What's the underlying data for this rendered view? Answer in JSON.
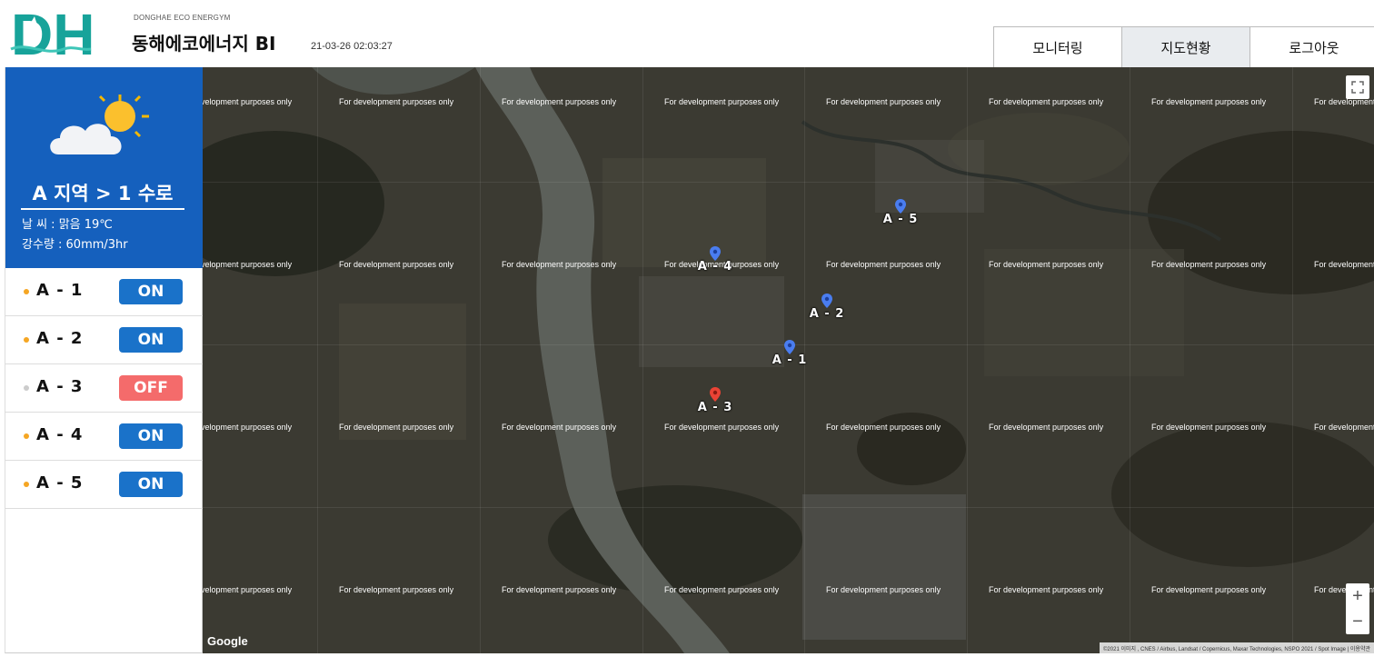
{
  "header": {
    "brand_sub": "DONGHAE ECO ENERGYM",
    "brand_title": "동해에코에너지 BI",
    "timestamp": "21-03-26 02:03:27",
    "logo_text": "DH",
    "tabs": [
      {
        "label": "모니터링",
        "active": false
      },
      {
        "label": "지도현황",
        "active": true
      },
      {
        "label": "로그아웃",
        "active": false
      }
    ]
  },
  "sidebar": {
    "weather_icon": "partly-cloudy-icon",
    "region_title": "A 지역 > 1 수로",
    "weather": "날    씨 : 맑음 19℃",
    "rainfall": "강수량 : 60mm/3hr",
    "sensors": [
      {
        "label": "A - 1",
        "status": "ON",
        "dot_color": "#f5a623"
      },
      {
        "label": "A - 2",
        "status": "ON",
        "dot_color": "#f5a623"
      },
      {
        "label": "A - 3",
        "status": "OFF",
        "dot_color": "#cccccc"
      },
      {
        "label": "A - 4",
        "status": "ON",
        "dot_color": "#f5a623"
      },
      {
        "label": "A - 5",
        "status": "ON",
        "dot_color": "#f5a623"
      }
    ]
  },
  "colors": {
    "accent": "#1560bd",
    "on": "#1a72c9",
    "off": "#f46b6b",
    "marker_on": "#4a7df0",
    "marker_off": "#ea4335"
  },
  "map": {
    "watermark": "For development purposes only",
    "google": "Google",
    "attribution": "©2021 이미지 , CNES / Airbus, Landsat / Copernicus, Maxar Technologies, NSPO 2021 / Spot Image | 이용약관",
    "zoom_in": "+",
    "zoom_out": "−",
    "markers": [
      {
        "label": "A - 1",
        "status": "ON"
      },
      {
        "label": "A - 2",
        "status": "ON"
      },
      {
        "label": "A - 3",
        "status": "OFF"
      },
      {
        "label": "A - 4",
        "status": "ON"
      },
      {
        "label": "A - 5",
        "status": "ON"
      }
    ]
  }
}
